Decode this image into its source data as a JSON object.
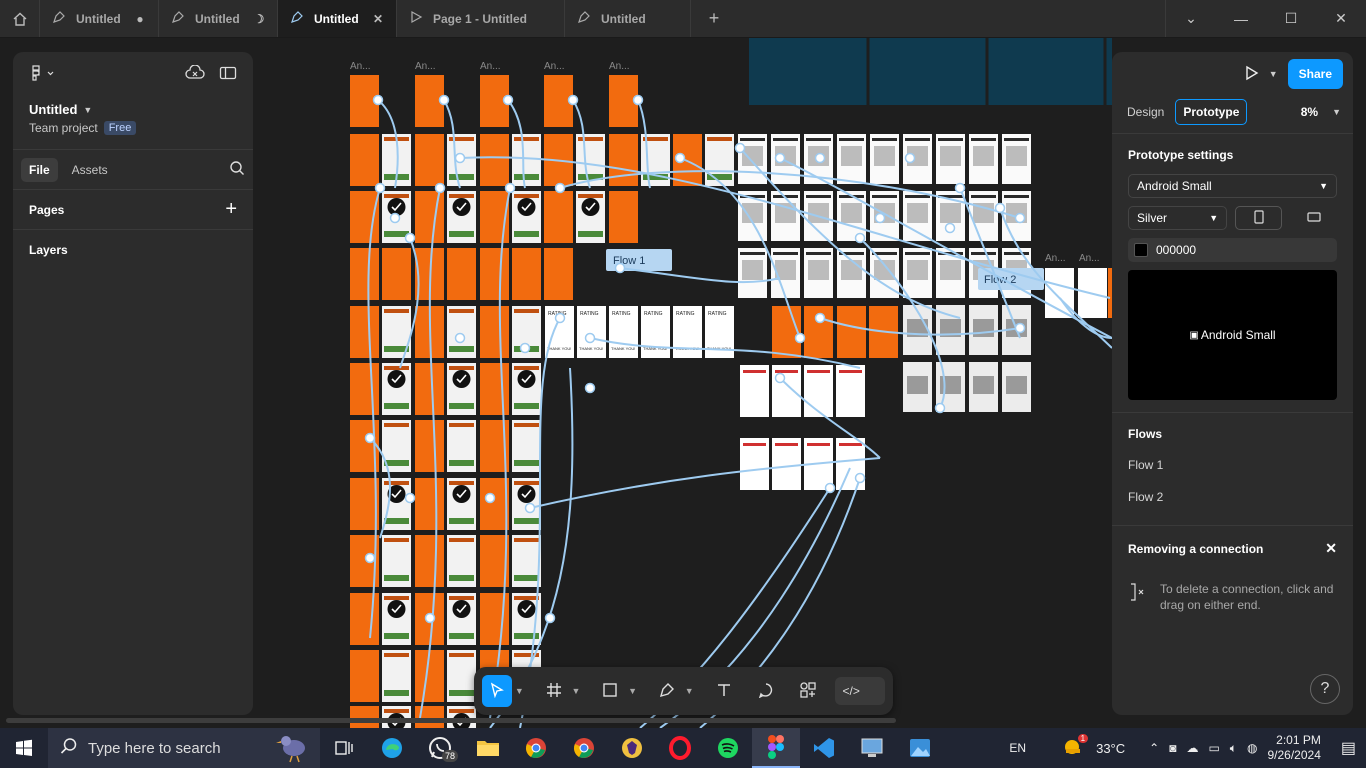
{
  "tabs": [
    {
      "label": "Untitled",
      "control": "●",
      "icon": "pen-icon"
    },
    {
      "label": "Untitled",
      "control": "☽",
      "icon": "pen-icon"
    },
    {
      "label": "Untitled",
      "control": "✕",
      "icon": "pen-icon"
    },
    {
      "label": "Page 1 - Untitled",
      "control": "",
      "icon": "play-icon"
    },
    {
      "label": "Untitled",
      "control": "",
      "icon": "pen-icon"
    }
  ],
  "left_panel": {
    "file_name": "Untitled",
    "team": "Team project",
    "plan_badge": "Free",
    "tab_file": "File",
    "tab_assets": "Assets",
    "pages_label": "Pages",
    "layers_label": "Layers"
  },
  "canvas": {
    "frame_label": "An...",
    "flow1_label": "Flow 1",
    "flow2_label": "Flow 2",
    "rating_label": "RATING",
    "thanks_label": "THANK YOU!"
  },
  "right_panel": {
    "share_label": "Share",
    "tab_design": "Design",
    "tab_prototype": "Prototype",
    "zoom": "8%",
    "proto_settings_heading": "Prototype settings",
    "device": "Android Small",
    "device_color": "Silver",
    "background_hex": "000000",
    "preview_alt": "Android Small",
    "flows_heading": "Flows",
    "flows": [
      "Flow 1",
      "Flow 2"
    ],
    "removing_heading": "Removing a connection",
    "removing_text": "To delete a connection, click and drag on either end.",
    "help": "?"
  },
  "taskbar": {
    "search_placeholder": "Type here to search",
    "whatsapp_count": "78",
    "weather_badge": "1",
    "language": "EN",
    "temperature": "33°C",
    "time": "2:01 PM",
    "date": "9/26/2024"
  },
  "colors": {
    "accent": "#0d99ff",
    "orange_frame": "#f26b0f",
    "connector": "#9ecbf0",
    "panel": "#2c2c2c",
    "canvas": "#1e1e1e"
  }
}
